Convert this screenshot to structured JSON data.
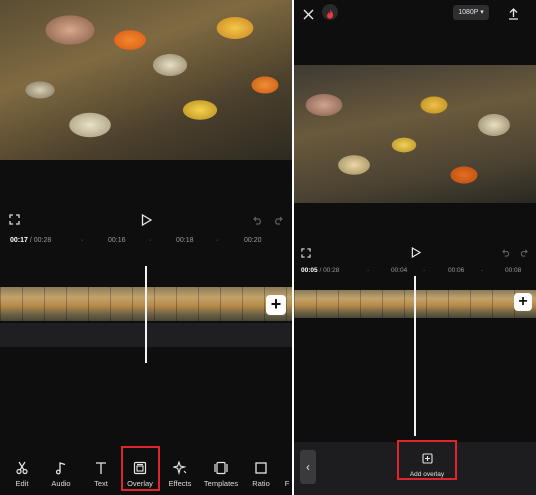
{
  "left": {
    "time": {
      "current": "00:17",
      "separator": "/",
      "total": "00:28"
    },
    "ticks": [
      "00:16",
      "00:18",
      "00:20"
    ],
    "toolbar": [
      {
        "name": "edit",
        "label": "Edit",
        "icon": "scissors-icon"
      },
      {
        "name": "audio",
        "label": "Audio",
        "icon": "music-note-icon"
      },
      {
        "name": "text",
        "label": "Text",
        "icon": "text-t-icon"
      },
      {
        "name": "overlay",
        "label": "Overlay",
        "icon": "overlay-icon"
      },
      {
        "name": "effects",
        "label": "Effects",
        "icon": "sparkle-icon"
      },
      {
        "name": "templates",
        "label": "Templates",
        "icon": "templates-icon"
      },
      {
        "name": "ratio",
        "label": "Ratio",
        "icon": "ratio-square-icon"
      },
      {
        "name": "more",
        "label": "F",
        "icon": ""
      }
    ],
    "highlighted_tool": "Overlay",
    "add_clip_symbol": "+"
  },
  "right": {
    "resolution": "1080P",
    "resolution_caret": "▾",
    "time": {
      "current": "00:05",
      "separator": "/",
      "total": "00:28"
    },
    "ticks": [
      "00:04",
      "00:06",
      "00:08"
    ],
    "add_clip_symbol": "+",
    "back_symbol": "‹",
    "add_overlay_label": "Add overlay"
  },
  "colors": {
    "background": "#0e0e0f",
    "highlight": "#e0262b",
    "playhead": "#f2f2f2"
  }
}
